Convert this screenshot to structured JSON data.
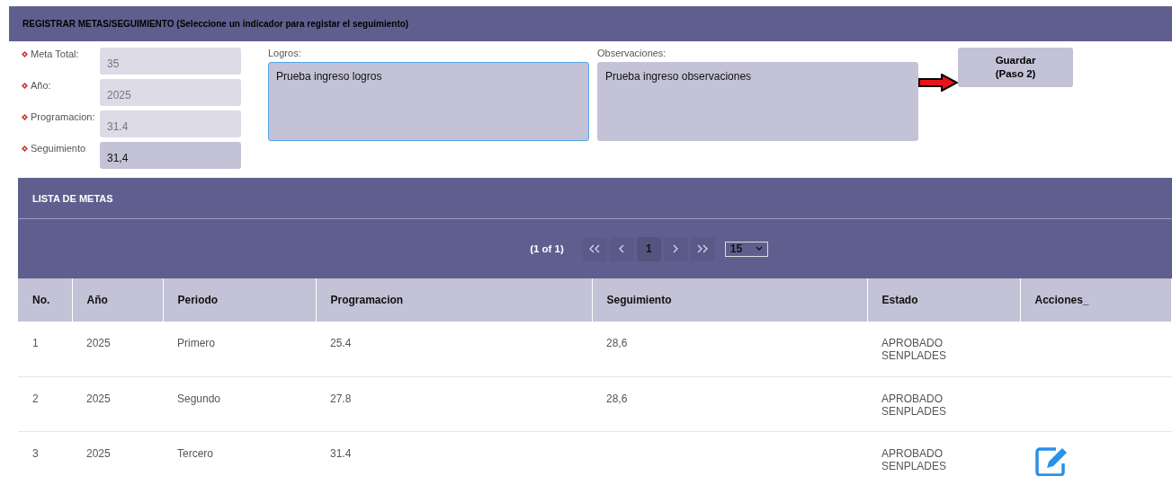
{
  "header": {
    "title": "REGISTRAR METAS/SEGUIMIENTO (Seleccione un indicador para registar el seguimiento)"
  },
  "fields": [
    {
      "label": "Meta Total:",
      "value": "35",
      "disabled": true
    },
    {
      "label": "Año:",
      "value": "2025",
      "disabled": true
    },
    {
      "label": "Programacion:",
      "value": "31.4",
      "disabled": true
    },
    {
      "label": "Seguimiento",
      "value": "31,4",
      "disabled": false
    }
  ],
  "text_areas": [
    {
      "label": "Logros:",
      "value": "Prueba ingreso logros",
      "focused": true
    },
    {
      "label": "Observaciones:",
      "value": "Prueba ingreso observaciones",
      "focused": false
    }
  ],
  "save_button": {
    "lines": [
      "Guardar",
      "(Paso 2)"
    ]
  },
  "list": {
    "title": "LISTA DE METAS",
    "pager": {
      "summary": "(1 of 1)",
      "pages": [
        {
          "label": "1",
          "selected": true
        }
      ],
      "page_size": "15"
    },
    "columns": [
      "No.",
      "Año",
      "Periodo",
      "Programacion",
      "Seguimiento",
      "Estado",
      "Acciones_"
    ],
    "rows": [
      {
        "cells": [
          "1",
          "2025",
          "Primero",
          "25.4",
          "28,6",
          "APROBADO SENPLADES"
        ],
        "editable": false
      },
      {
        "cells": [
          "2",
          "2025",
          "Segundo",
          "27.8",
          "28,6",
          "APROBADO SENPLADES"
        ],
        "editable": false
      },
      {
        "cells": [
          "3",
          "2025",
          "Tercero",
          "31.4",
          "",
          "APROBADO SENPLADES"
        ],
        "editable": true
      }
    ]
  }
}
